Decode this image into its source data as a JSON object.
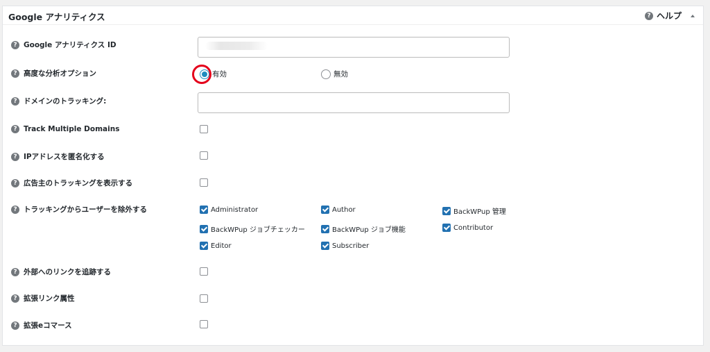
{
  "panel": {
    "title": "Google アナリティクス",
    "help_label": "ヘルプ"
  },
  "rows": [
    {
      "label": "Google アナリティクス ID"
    },
    {
      "label": "高度な分析オプション"
    },
    {
      "label": "ドメインのトラッキング:"
    },
    {
      "label": "Track Multiple Domains"
    },
    {
      "label": "IPアドレスを匿名化する"
    },
    {
      "label": "広告主のトラッキングを表示する"
    },
    {
      "label": "トラッキングからユーザーを除外する"
    },
    {
      "label": "外部へのリンクを追跡する"
    },
    {
      "label": "拡張リンク属性"
    },
    {
      "label": "拡張eコマース"
    }
  ],
  "analytics_id": {
    "value": "",
    "placeholder": ""
  },
  "advanced_options": {
    "enabled_label": "有効",
    "disabled_label": "無効",
    "selected": "有効"
  },
  "domain_tracking": {
    "value": "",
    "placeholder": ""
  },
  "checkboxes": {
    "track_multiple_domains": false,
    "anonymize_ip": false,
    "advertiser_tracking": false,
    "track_outbound": false,
    "enhanced_link_attr": false,
    "enhanced_ecommerce": false
  },
  "excluded_roles": [
    {
      "label": "Administrator",
      "checked": true
    },
    {
      "label": "Author",
      "checked": true
    },
    {
      "label": "BackWPup 管理",
      "checked": true
    },
    {
      "label": "BackWPup ジョブチェッカー",
      "checked": true
    },
    {
      "label": "BackWPup ジョブ機能",
      "checked": true
    },
    {
      "label": "Contributor",
      "checked": true
    },
    {
      "label": "Editor",
      "checked": true
    },
    {
      "label": "Subscriber",
      "checked": true
    }
  ],
  "colors": {
    "accent": "#2271b1",
    "highlight_ring": "#e4001b"
  },
  "icons": [
    "question-mark-icon",
    "collapse-arrow-icon"
  ]
}
